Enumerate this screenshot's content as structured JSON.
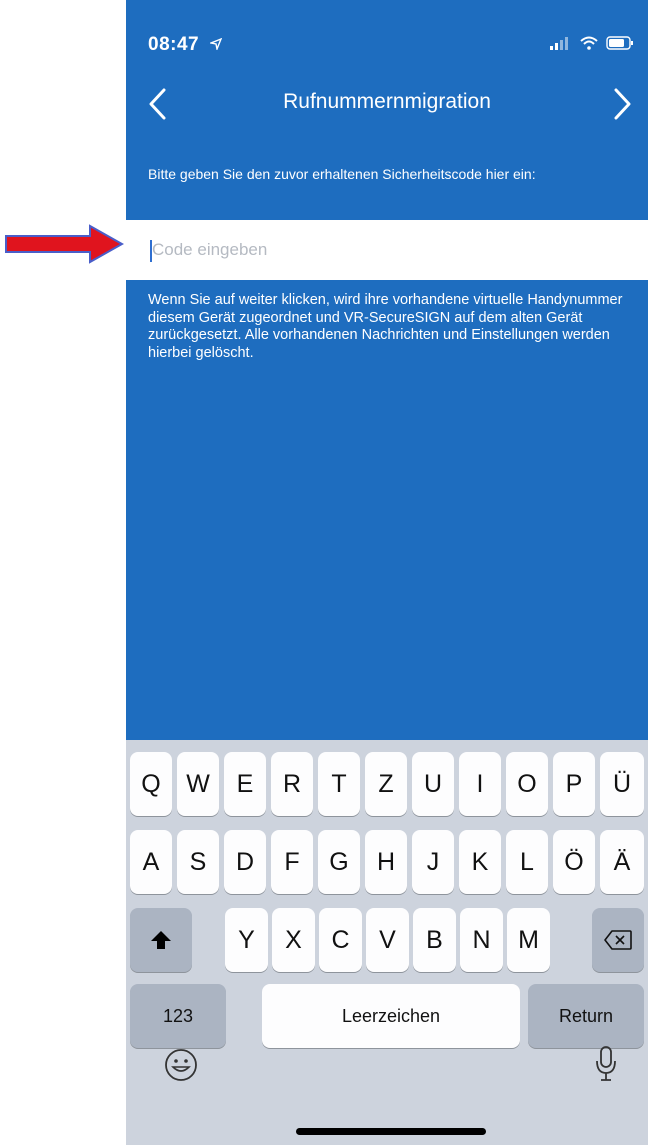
{
  "status": {
    "time": "08:47"
  },
  "nav": {
    "title": "Rufnummernmigration"
  },
  "instruction": "Bitte geben Sie den zuvor erhaltenen Sicherheitscode hier ein:",
  "code_input": {
    "placeholder": "Code eingeben",
    "value": ""
  },
  "info": "Wenn Sie auf weiter klicken, wird ihre vorhandene virtuelle Handynummer diesem Gerät zugeordnet und VR-SecureSIGN auf dem alten Gerät zurückgesetzt. Alle vorhandenen Nachrichten und Einstellungen werden hierbei gelöscht.",
  "keyboard": {
    "row1": [
      "Q",
      "W",
      "E",
      "R",
      "T",
      "Z",
      "U",
      "I",
      "O",
      "P",
      "Ü"
    ],
    "row2": [
      "A",
      "S",
      "D",
      "F",
      "G",
      "H",
      "J",
      "K",
      "L",
      "Ö",
      "Ä"
    ],
    "row3": [
      "Y",
      "X",
      "C",
      "V",
      "B",
      "N",
      "M"
    ],
    "numbers_label": "123",
    "space_label": "Leerzeichen",
    "return_label": "Return"
  },
  "icons": {
    "status": [
      "location-arrow-icon",
      "signal-icon",
      "wifi-icon",
      "battery-icon"
    ],
    "nav": [
      "back-chevron-icon",
      "forward-chevron-icon"
    ],
    "keyboard": [
      "shift-icon",
      "backspace-icon",
      "emoji-icon",
      "microphone-icon"
    ],
    "annotation": "red-arrow-icon"
  },
  "colors": {
    "header_blue": "#1e6dbf",
    "keyboard_bg": "#cdd3dd",
    "arrow_red": "#e0141e"
  }
}
